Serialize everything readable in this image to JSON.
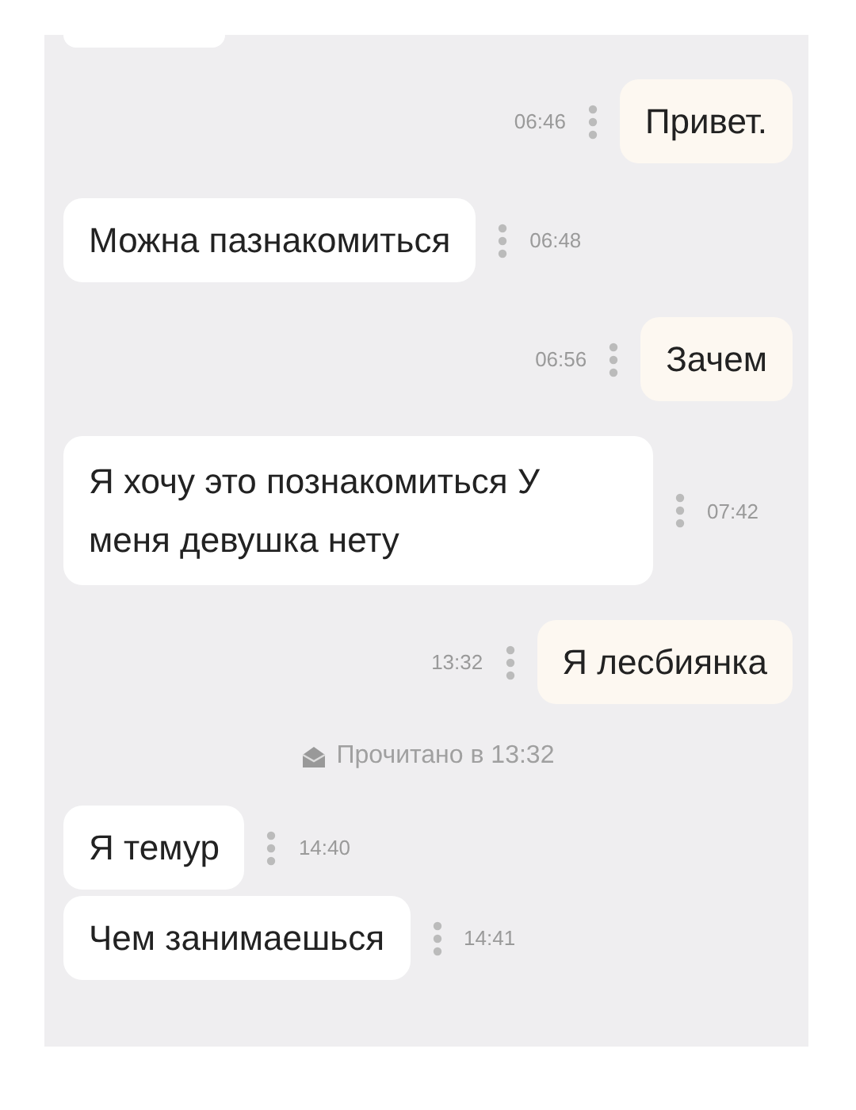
{
  "messages": [
    {
      "kind": "outgoing",
      "text": "Привет.",
      "time": "06:46"
    },
    {
      "kind": "incoming",
      "text": "Можна пазнакомиться",
      "time": "06:48"
    },
    {
      "kind": "outgoing",
      "text": "Зачем",
      "time": "06:56"
    },
    {
      "kind": "incoming",
      "text": "Я хочу это познакомиться У меня девушка нету",
      "time": "07:42"
    },
    {
      "kind": "outgoing",
      "text": "Я лесбиянка",
      "time": "13:32"
    },
    {
      "kind": "receipt",
      "text": "Прочитано в 13:32"
    },
    {
      "kind": "incoming",
      "text": "Я темур",
      "time": "14:40"
    },
    {
      "kind": "incoming",
      "text": "Чем занимаешься",
      "time": "14:41"
    }
  ]
}
